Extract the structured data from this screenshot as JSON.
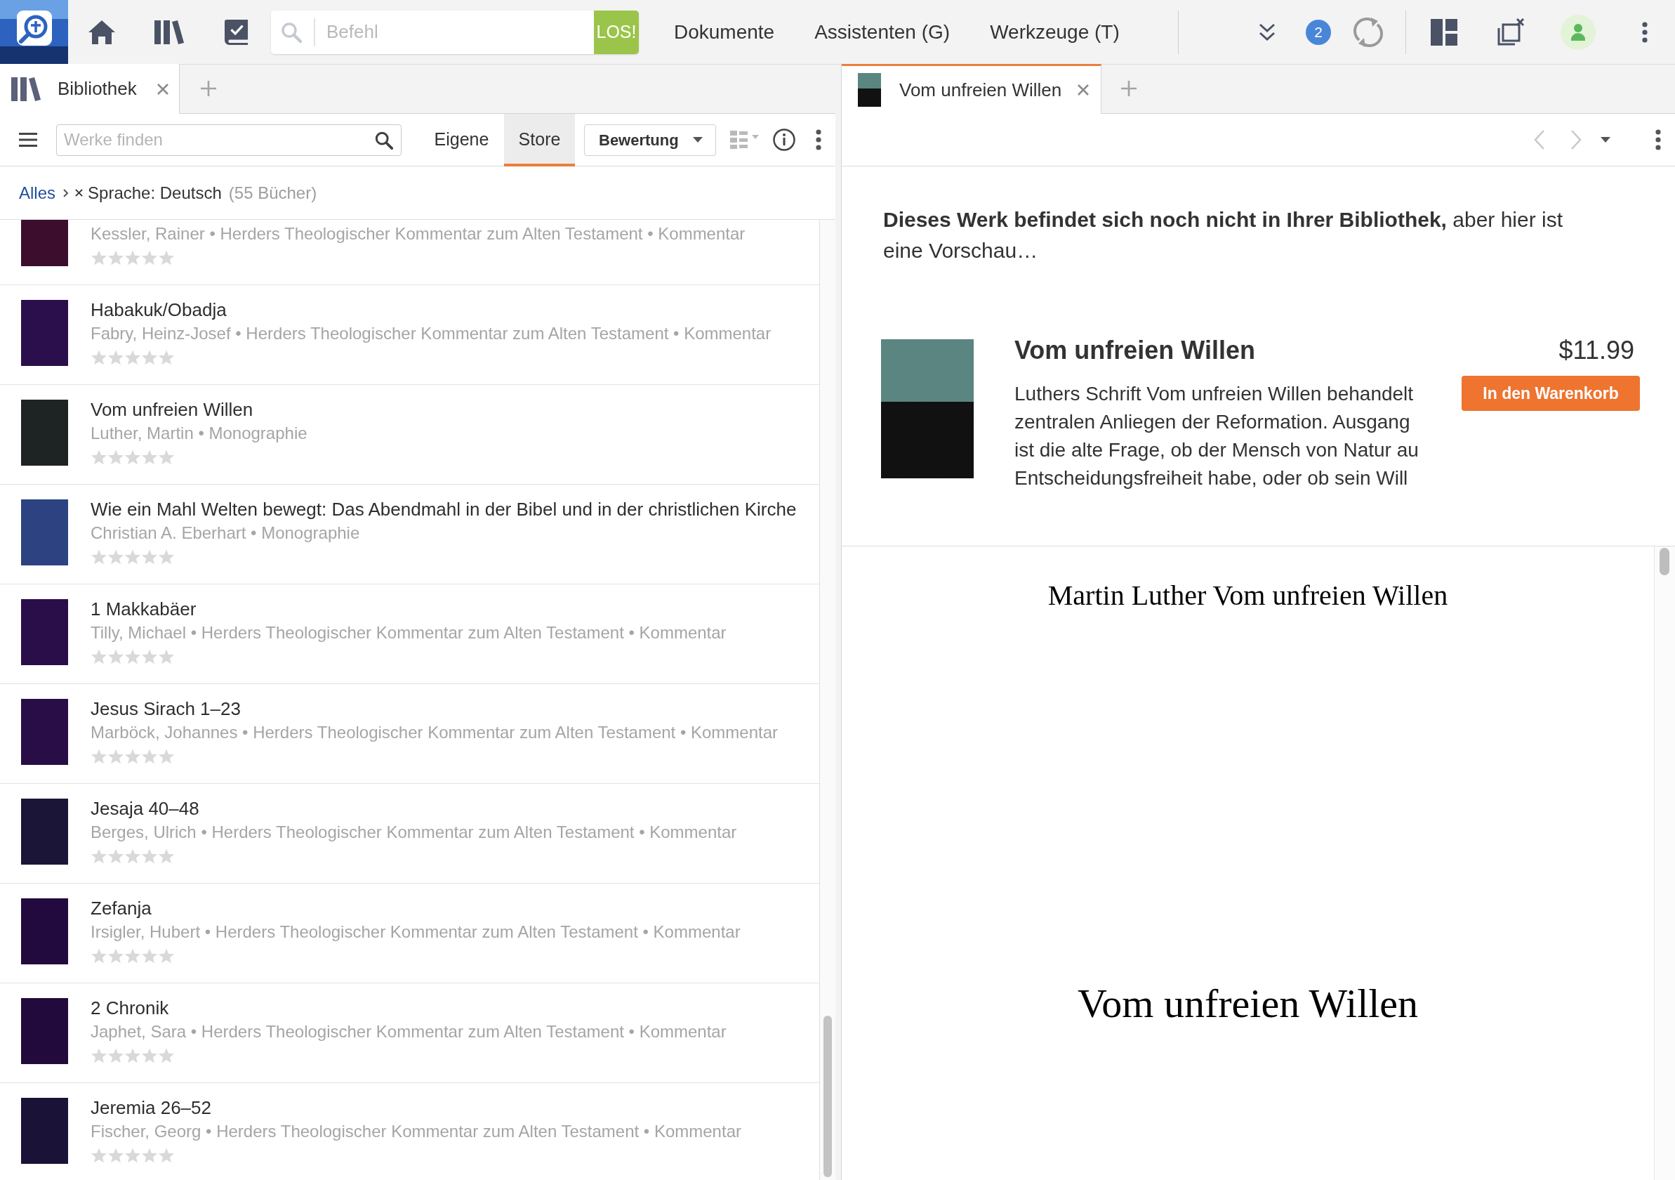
{
  "app_bar": {
    "command": {
      "placeholder": "Befehl",
      "button": "LOS!"
    },
    "menus": [
      "Dokumente",
      "Assistenten (G)",
      "Werkzeuge (T)"
    ],
    "notifications": "2"
  },
  "library_panel": {
    "tabs": [
      {
        "label": "Bibliothek",
        "selected": true
      }
    ],
    "search": {
      "placeholder": "Werke finden"
    },
    "views": [
      {
        "label": "Eigene",
        "selected": false
      },
      {
        "label": "Store",
        "selected": true
      }
    ],
    "sort": "Bewertung",
    "breadcrumb": {
      "root": "Alles",
      "filter": "Sprache: Deutsch",
      "count": "(55 Bücher)"
    },
    "books": [
      {
        "meta": "Kessler, Rainer • Herders Theologischer Kommentar zum Alten Testament • Kommentar",
        "stars": 0,
        "color": "#3d0d2e"
      },
      {
        "title": "Habakuk/Obadja",
        "meta": "Fabry, Heinz-Josef • Herders Theologischer Kommentar zum Alten Testament • Kommentar",
        "stars": 0,
        "color": "#2b0f4d"
      },
      {
        "title": "Vom unfreien Willen",
        "meta": "Luther, Martin • Monographie",
        "stars": 0,
        "color": "#1e2424"
      },
      {
        "title": "Wie ein Mahl Welten bewegt: Das Abendmahl in der Bibel und in der christlichen Kirche",
        "meta": "Christian A. Eberhart • Monographie",
        "stars": 0,
        "color": "#2c4281"
      },
      {
        "title": "1 Makkabäer",
        "meta": "Tilly, Michael • Herders Theologischer Kommentar zum Alten Testament • Kommentar",
        "stars": 0,
        "color": "#2a0e4a"
      },
      {
        "title": "Jesus Sirach 1–23",
        "meta": "Marböck, Johannes • Herders Theologischer Kommentar zum Alten Testament • Kommentar",
        "stars": 0,
        "color": "#280d47"
      },
      {
        "title": "Jesaja 40–48",
        "meta": "Berges, Ulrich • Herders Theologischer Kommentar zum Alten Testament • Kommentar",
        "stars": 0,
        "color": "#1b1638"
      },
      {
        "title": "Zefanja",
        "meta": "Irsigler, Hubert • Herders Theologischer Kommentar zum Alten Testament • Kommentar",
        "stars": 0,
        "color": "#230a3e"
      },
      {
        "title": "2 Chronik",
        "meta": "Japhet, Sara • Herders Theologischer Kommentar zum Alten Testament • Kommentar",
        "stars": 0,
        "color": "#220a3c"
      },
      {
        "title": "Jeremia 26–52",
        "meta": "Fischer, Georg • Herders Theologischer Kommentar zum Alten Testament • Kommentar",
        "stars": 0,
        "color": "#1b1238"
      }
    ]
  },
  "reader_panel": {
    "tabs": [
      {
        "label": "Vom unfreien Willen",
        "selected": true
      }
    ],
    "notice": "**Dieses Werk befindet sich noch nicht in Ihrer Bibliothek,** aber hier ist eine Vorschau…",
    "product": {
      "title": "Vom unfreien Willen",
      "description": [
        "Luthers Schrift Vom unfreien Willen behandelt",
        "zentralen Anliegen der Reformation. Ausgang",
        "ist die alte Frage, ob der Mensch von Natur au",
        "Entscheidungsfreiheit habe, oder ob sein Will"
      ],
      "price": "$11.99",
      "button": "In den Warenkorb"
    },
    "preview": {
      "header": "Martin Luther Vom unfreien Willen",
      "title": "Vom unfreien Willen"
    }
  }
}
